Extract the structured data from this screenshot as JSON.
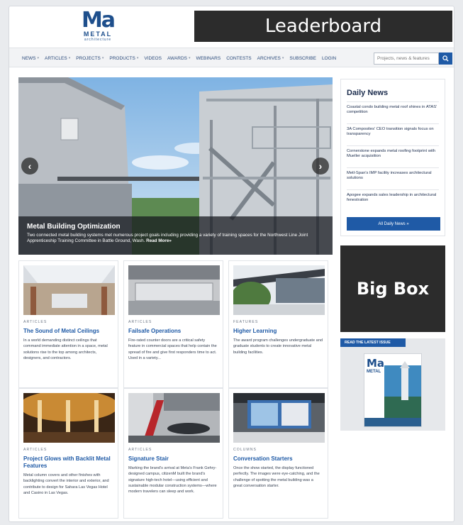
{
  "header": {
    "logo": {
      "mark": "Ma",
      "word": "METAL",
      "sub": "architecture"
    },
    "leaderboard": "Leaderboard"
  },
  "nav": {
    "items": [
      {
        "label": "NEWS",
        "caret": true
      },
      {
        "label": "ARTICLES",
        "caret": true
      },
      {
        "label": "PROJECTS",
        "caret": true
      },
      {
        "label": "PRODUCTS",
        "caret": true
      },
      {
        "label": "VIDEOS",
        "caret": false
      },
      {
        "label": "AWARDS",
        "caret": true
      },
      {
        "label": "WEBINARS",
        "caret": false
      },
      {
        "label": "CONTESTS",
        "caret": false
      },
      {
        "label": "ARCHIVES",
        "caret": true
      },
      {
        "label": "SUBSCRIBE",
        "caret": false
      },
      {
        "label": "LOGIN",
        "caret": false
      }
    ],
    "search_placeholder": "Projects, news & features",
    "search_icon": "search-icon"
  },
  "hero": {
    "title": "Metal Building Optimization",
    "text": "Two connected metal building systems met numerous project goals including providing a variety of training spaces for the Northwest Line Joint Apprenticeship Training Committee in Battle Ground, Wash.",
    "read_more": "Read More»",
    "prev_icon": "chevron-left-icon",
    "next_icon": "chevron-right-icon"
  },
  "daily_news": {
    "title": "Daily News",
    "items": [
      "Coastal condo building metal roof shines in ATAS' competition",
      "3A Composites' CEO transition signals focus on transparency",
      "Cornerstone expands metal roofing footprint with Mueller acquisition",
      "Metl-Span's IMP facility increases architectural solutions",
      "Apogee expands sales leadership in architectural fenestration"
    ],
    "button": "All Daily News »"
  },
  "big_box": "Big Box",
  "latest_issue": {
    "tag": "READ THE LATEST ISSUE",
    "cover_mark": "Ma",
    "cover_word": "METAL"
  },
  "cards": [
    {
      "tag": "ARTICLES",
      "title": "The Sound of Metal Ceilings",
      "text": "In a world demanding distinct ceilings that command immediate attention in a space, metal solutions rise to the top among architects, designers, and contractors."
    },
    {
      "tag": "ARTICLES",
      "title": "Failsafe Operations",
      "text": "Fire-rated counter doors are a critical safety feature in commercial spaces that help contain the spread of fire and give first responders time to act. Used in a variety..."
    },
    {
      "tag": "FEATURES",
      "title": "Higher Learning",
      "text": "The award program challenges undergraduate and graduate students to create innovative metal building facilities."
    },
    {
      "tag": "ARTICLES",
      "title": "Project Glows with Backlit Metal Features",
      "text": "Metal column covers and other finishes with backlighting convert the interior and exterior, and contribute to design for Sahara Las Vegas Hotel and Casino in Las Vegas."
    },
    {
      "tag": "ARTICLES",
      "title": "Signature Stair",
      "text": "Marking the brand's arrival at Meta's Frank Gehry-designed campus, citizenM built the brand's signature high-tech hotel—using efficient and sustainable modular construction systems—where modern travelers can sleep and work."
    },
    {
      "tag": "COLUMNS",
      "title": "Conversation Starters",
      "text": "Once the show started, the display functioned perfectly. The images were eye-catching, and the challenge of spotting the metal building was a great conversation starter."
    }
  ],
  "colors": {
    "brand_blue": "#1f5aa6",
    "ad_dark": "#2c2c2c",
    "logo_blue": "#1e4f8c"
  }
}
